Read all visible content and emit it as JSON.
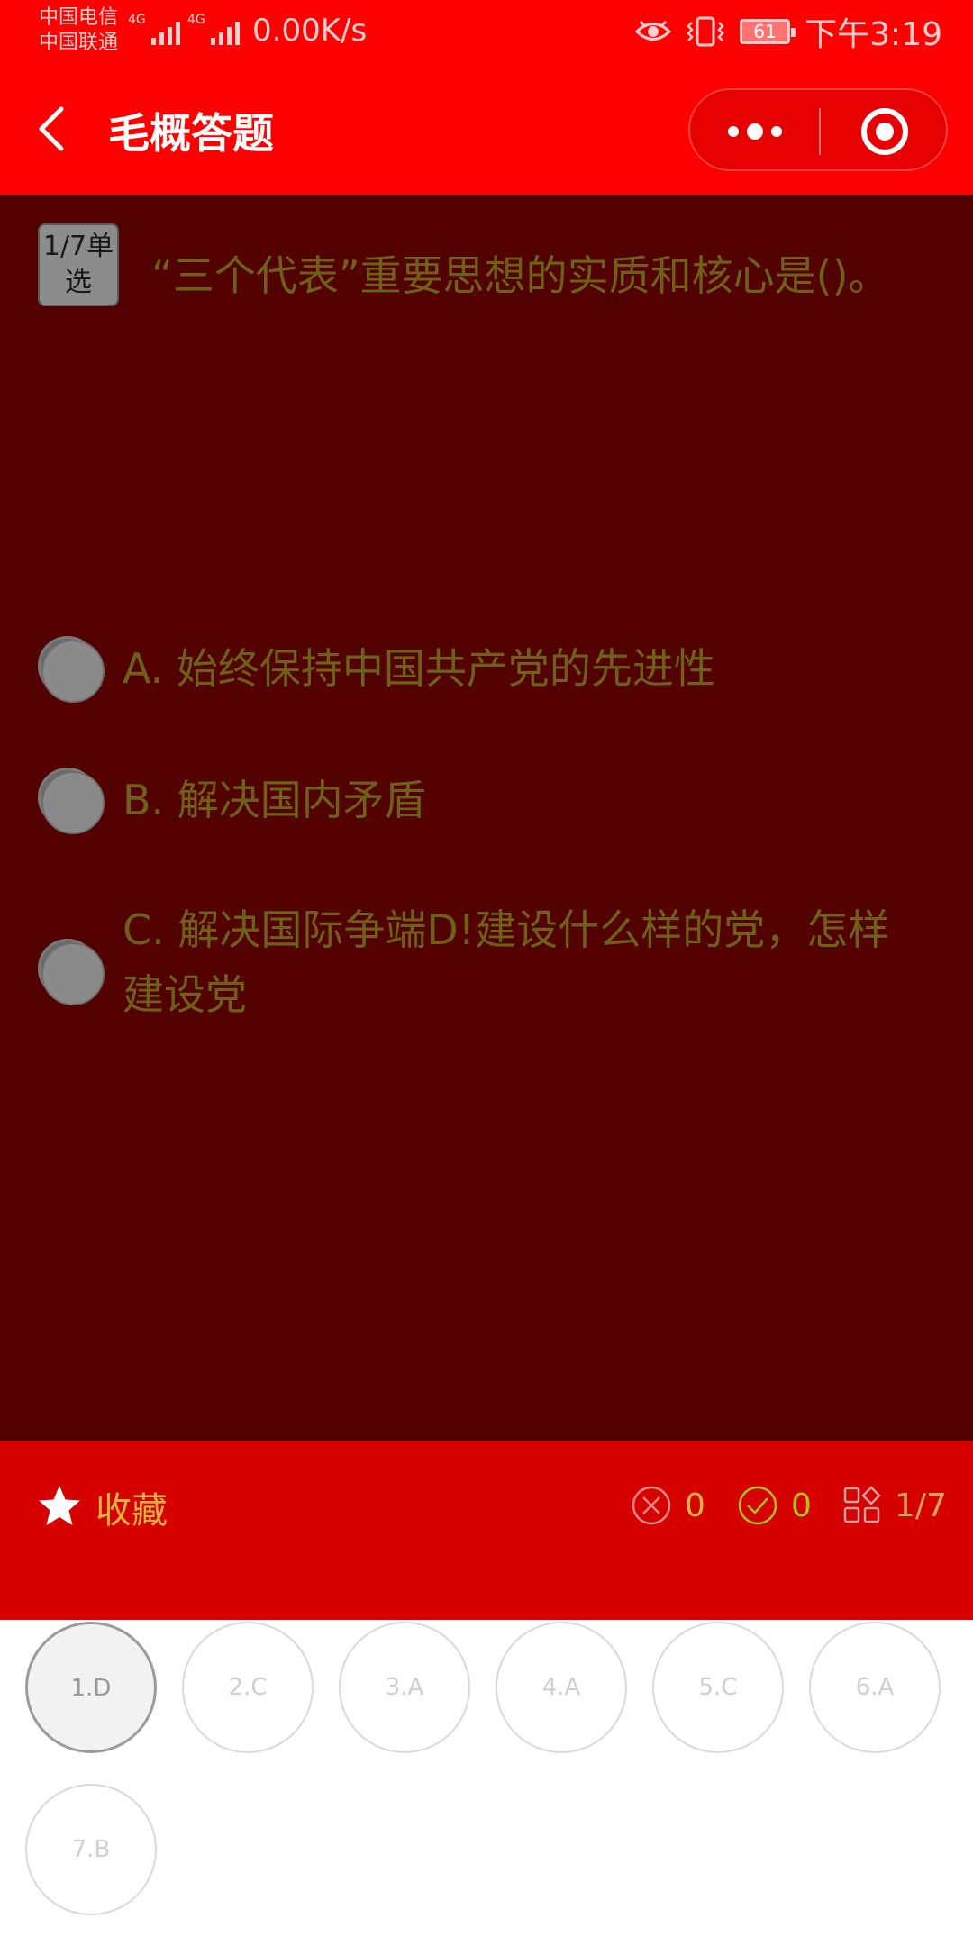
{
  "status_bar": {
    "carrier_1": "中国电信",
    "carrier_2": "中国联通",
    "network_1": "4G",
    "network_2": "4G",
    "net_speed": "0.00K/s",
    "battery": "61",
    "time": "下午3:19"
  },
  "nav": {
    "title": "毛概答题",
    "back_icon": "chevron-left-icon",
    "more_icon": "more-dots-icon",
    "close_icon": "target-icon"
  },
  "question": {
    "tag": "1/7单选",
    "text": "“三个代表”重要思想的实质和核心是()。",
    "options": [
      {
        "label": "A. 始终保持中国共产党的先进性"
      },
      {
        "label": "B. 解决国内矛盾"
      },
      {
        "label": "C. 解决国际争端D!建设什么样的党，怎样建设党"
      }
    ]
  },
  "toolbar": {
    "favorite_label": "收藏",
    "wrong_count": "0",
    "right_count": "0",
    "progress": "1/7"
  },
  "answer_sheet": [
    {
      "label": "1.D",
      "current": true
    },
    {
      "label": "2.C",
      "current": false
    },
    {
      "label": "3.A",
      "current": false
    },
    {
      "label": "4.A",
      "current": false
    },
    {
      "label": "5.C",
      "current": false
    },
    {
      "label": "6.A",
      "current": false
    },
    {
      "label": "7.B",
      "current": false
    }
  ],
  "colors": {
    "brand_red": "#ff0000",
    "overlay": "#520000",
    "toolbar_red": "#d60000"
  }
}
